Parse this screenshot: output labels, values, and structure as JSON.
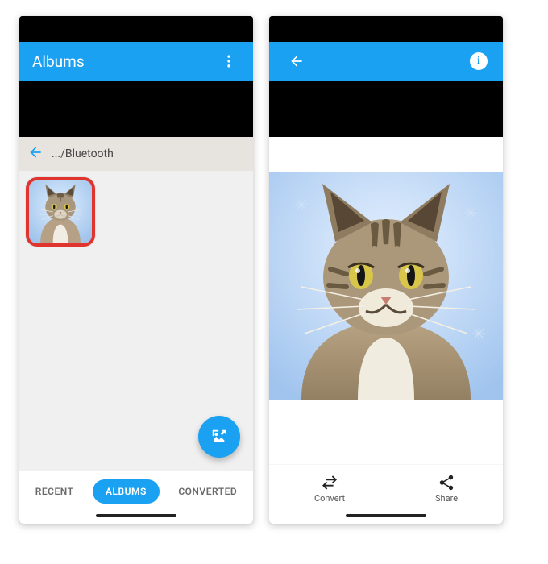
{
  "left": {
    "app_bar_title": "Albums",
    "breadcrumb_text": ".../Bluetooth",
    "tabs": [
      "RECENT",
      "ALBUMS",
      "CONVERTED"
    ],
    "active_tab_index": 1
  },
  "right": {
    "actions": {
      "convert": "Convert",
      "share": "Share"
    }
  }
}
